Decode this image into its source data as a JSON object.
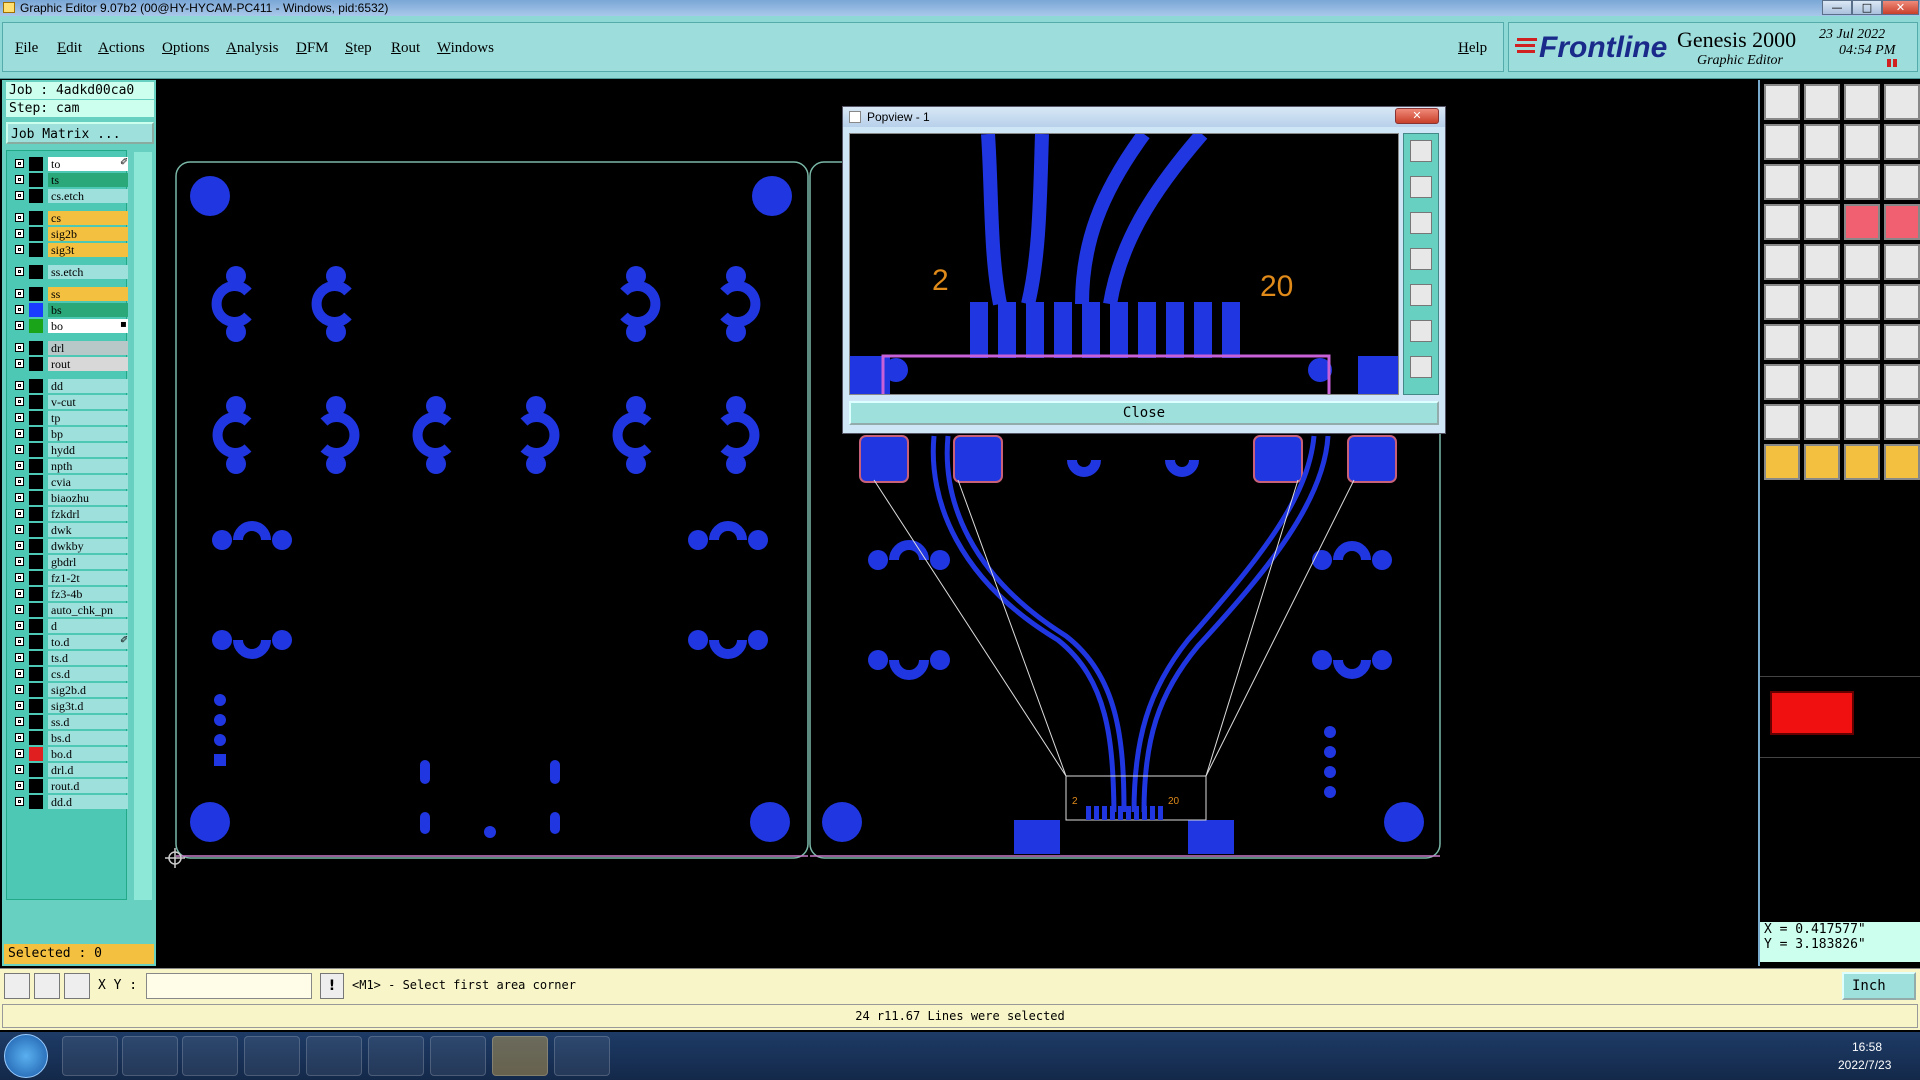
{
  "window": {
    "title": "Graphic Editor 9.07b2 (00@HY-HYCAM-PC411 - Windows, pid:6532)",
    "controls": [
      "—",
      "□",
      "✕"
    ]
  },
  "menu": {
    "items": [
      "File",
      "Edit",
      "Actions",
      "Options",
      "Analysis",
      "DFM",
      "Step",
      "Rout",
      "Windows"
    ],
    "help": "Help"
  },
  "brand": {
    "logo": "Frontline",
    "product": "Genesis 2000",
    "subtitle": "Graphic Editor",
    "date": "23 Jul 2022",
    "time": "04:54 PM"
  },
  "left_panel": {
    "job": "Job : 4adkd00ca0",
    "step": "Step: cam",
    "job_matrix": "Job Matrix ...",
    "selected": "Selected : 0",
    "layers": [
      {
        "name": "to",
        "bg": "#ffffff",
        "sw": "#000000",
        "mark": "✐"
      },
      {
        "name": "ts",
        "bg": "#2aa87a",
        "sw": "#000000",
        "mark": ""
      },
      {
        "name": "cs.etch",
        "bg": "#9ee0dc",
        "sw": "#000000",
        "mark": ""
      },
      {
        "name": "cs",
        "bg": "#f4c040",
        "sw": "#000000",
        "mark": ""
      },
      {
        "name": "sig2b",
        "bg": "#f4c040",
        "sw": "#000000",
        "mark": ""
      },
      {
        "name": "sig3t",
        "bg": "#f4c040",
        "sw": "#000000",
        "mark": ""
      },
      {
        "name": "ss.etch",
        "bg": "#9ee0dc",
        "sw": "#000000",
        "mark": ""
      },
      {
        "name": "ss",
        "bg": "#f4c040",
        "sw": "#000000",
        "mark": ""
      },
      {
        "name": "bs",
        "bg": "#2aa87a",
        "sw": "#1a3cff",
        "mark": ""
      },
      {
        "name": "bo",
        "bg": "#ffffff",
        "sw": "#1aa41a",
        "mark": "▪"
      },
      {
        "name": "drl",
        "bg": "#b8c8c8",
        "sw": "#000000",
        "mark": ""
      },
      {
        "name": "rout",
        "bg": "#d8d8d8",
        "sw": "#000000",
        "mark": ""
      },
      {
        "name": "dd",
        "bg": "#9ee0dc",
        "sw": "#000000",
        "mark": ""
      },
      {
        "name": "v-cut",
        "bg": "#9ee0dc",
        "sw": "#000000",
        "mark": ""
      },
      {
        "name": "tp",
        "bg": "#9ee0dc",
        "sw": "#000000",
        "mark": ""
      },
      {
        "name": "bp",
        "bg": "#9ee0dc",
        "sw": "#000000",
        "mark": ""
      },
      {
        "name": "hydd",
        "bg": "#9ee0dc",
        "sw": "#000000",
        "mark": ""
      },
      {
        "name": "npth",
        "bg": "#9ee0dc",
        "sw": "#000000",
        "mark": ""
      },
      {
        "name": "cvia",
        "bg": "#9ee0dc",
        "sw": "#000000",
        "mark": ""
      },
      {
        "name": "biaozhu",
        "bg": "#9ee0dc",
        "sw": "#000000",
        "mark": ""
      },
      {
        "name": "fzkdrl",
        "bg": "#9ee0dc",
        "sw": "#000000",
        "mark": ""
      },
      {
        "name": "dwk",
        "bg": "#9ee0dc",
        "sw": "#000000",
        "mark": ""
      },
      {
        "name": "dwkby",
        "bg": "#9ee0dc",
        "sw": "#000000",
        "mark": ""
      },
      {
        "name": "gbdrl",
        "bg": "#9ee0dc",
        "sw": "#000000",
        "mark": ""
      },
      {
        "name": "fz1-2t",
        "bg": "#9ee0dc",
        "sw": "#000000",
        "mark": ""
      },
      {
        "name": "fz3-4b",
        "bg": "#9ee0dc",
        "sw": "#000000",
        "mark": ""
      },
      {
        "name": "auto_chk_pn",
        "bg": "#9ee0dc",
        "sw": "#000000",
        "mark": ""
      },
      {
        "name": "d",
        "bg": "#9ee0dc",
        "sw": "#000000",
        "mark": ""
      },
      {
        "name": "to.d",
        "bg": "#9ee0dc",
        "sw": "#000000",
        "mark": "✐"
      },
      {
        "name": "ts.d",
        "bg": "#9ee0dc",
        "sw": "#000000",
        "mark": ""
      },
      {
        "name": "cs.d",
        "bg": "#9ee0dc",
        "sw": "#000000",
        "mark": ""
      },
      {
        "name": "sig2b.d",
        "bg": "#9ee0dc",
        "sw": "#000000",
        "mark": ""
      },
      {
        "name": "sig3t.d",
        "bg": "#9ee0dc",
        "sw": "#000000",
        "mark": ""
      },
      {
        "name": "ss.d",
        "bg": "#9ee0dc",
        "sw": "#000000",
        "mark": ""
      },
      {
        "name": "bs.d",
        "bg": "#9ee0dc",
        "sw": "#000000",
        "mark": ""
      },
      {
        "name": "bo.d",
        "bg": "#9ee0dc",
        "sw": "#e02020",
        "mark": ""
      },
      {
        "name": "drl.d",
        "bg": "#9ee0dc",
        "sw": "#000000",
        "mark": ""
      },
      {
        "name": "rout.d",
        "bg": "#9ee0dc",
        "sw": "#000000",
        "mark": ""
      },
      {
        "name": "dd.d",
        "bg": "#9ee0dc",
        "sw": "#000000",
        "mark": ""
      }
    ]
  },
  "canvas": {
    "label_left": "2",
    "label_right": "20"
  },
  "popview": {
    "title": "Popview - 1",
    "label_left": "2",
    "label_right": "20",
    "close": "Close"
  },
  "right_panel": {
    "coord_x": "X = 0.417577\"",
    "coord_y": "Y = 3.183826\""
  },
  "command_bar": {
    "xy_label": "X Y :",
    "xy_value": "",
    "prompt": "<M1> - Select first area corner",
    "units": "Inch"
  },
  "status": {
    "message": "24 r11.67 Lines were selected"
  },
  "taskbar": {
    "time": "16:58",
    "date": "2022/7/23"
  },
  "colors": {
    "trace": "#1a2ee8",
    "outline": "#7ab8a8",
    "label": "#e08a1a",
    "pad_fill": "#2036e0"
  }
}
